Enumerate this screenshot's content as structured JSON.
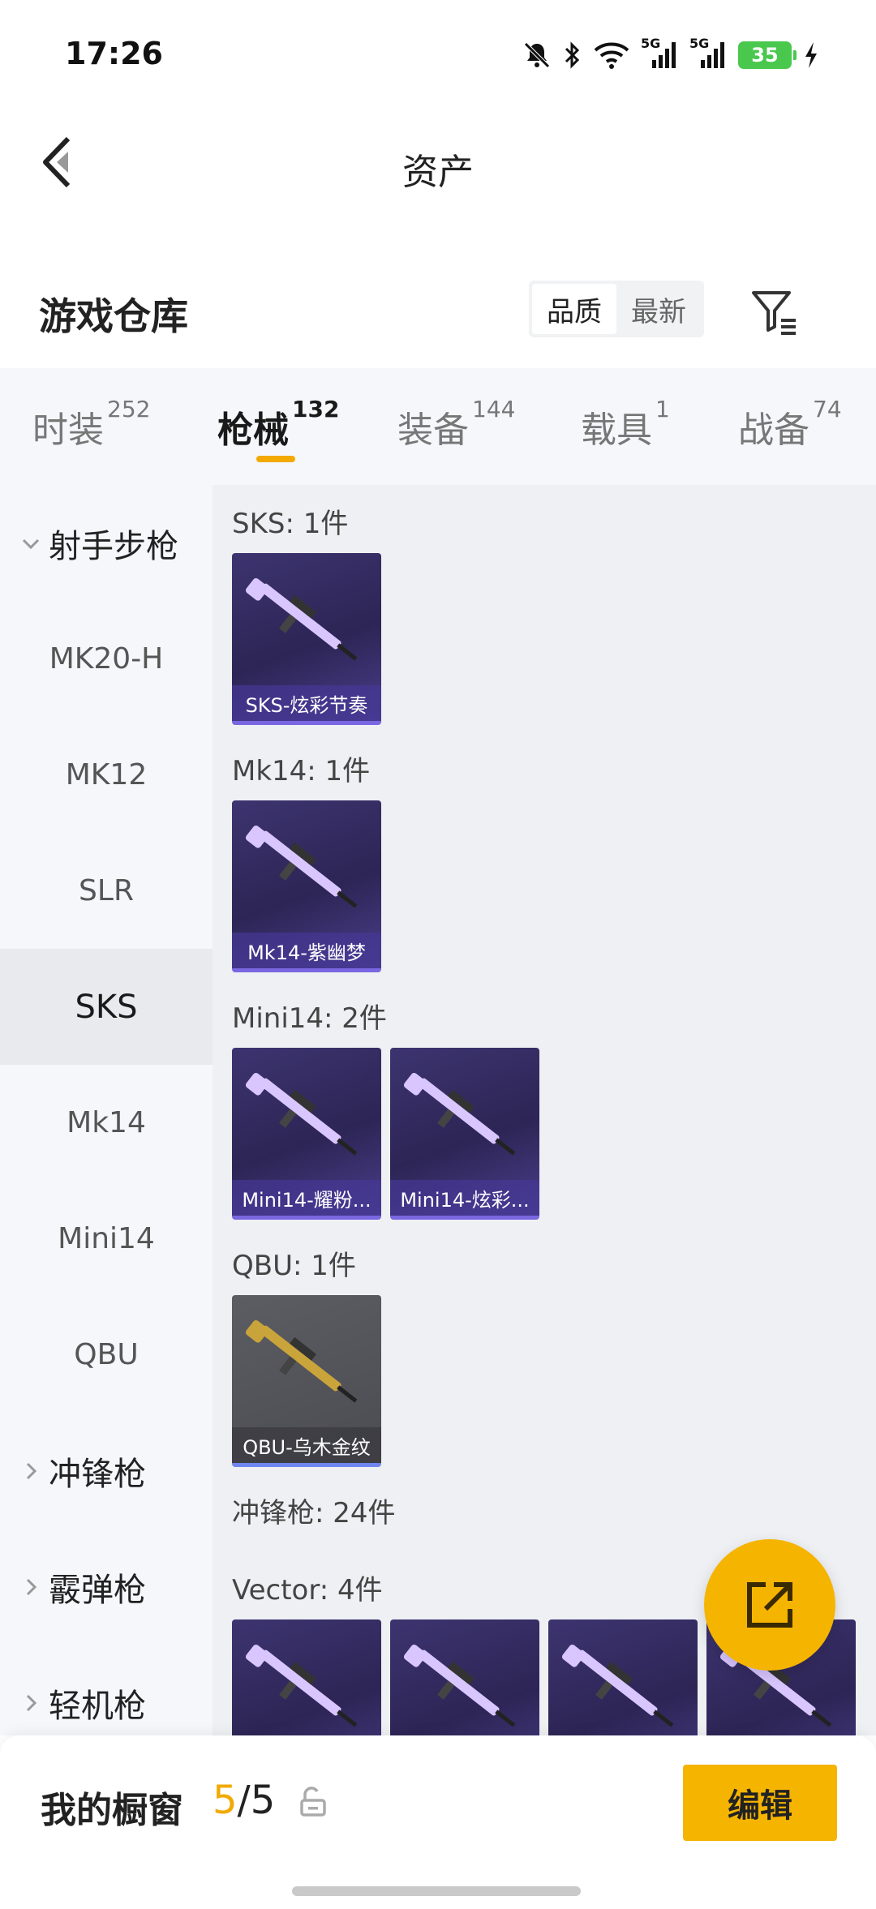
{
  "status_bar": {
    "time": "17:26",
    "network_a": "5G",
    "network_b": "5G",
    "battery": "35"
  },
  "header": {
    "title": "资产"
  },
  "warehouse": {
    "title": "游戏仓库",
    "sort_options": [
      "品质",
      "最新"
    ]
  },
  "tabs": [
    {
      "label": "时装",
      "count": "252"
    },
    {
      "label": "枪械",
      "count": "132"
    },
    {
      "label": "装备",
      "count": "144"
    },
    {
      "label": "载具",
      "count": "1"
    },
    {
      "label": "战备",
      "count": "74"
    }
  ],
  "sidebar": [
    {
      "label": "射手步枪",
      "type": "group",
      "expanded": true
    },
    {
      "label": "MK20-H",
      "type": "item"
    },
    {
      "label": "MK12",
      "type": "item"
    },
    {
      "label": "SLR",
      "type": "item"
    },
    {
      "label": "SKS",
      "type": "item",
      "selected": true
    },
    {
      "label": "Mk14",
      "type": "item"
    },
    {
      "label": "Mini14",
      "type": "item"
    },
    {
      "label": "QBU",
      "type": "item"
    },
    {
      "label": "冲锋枪",
      "type": "group",
      "expanded": false
    },
    {
      "label": "霰弹枪",
      "type": "group",
      "expanded": false
    },
    {
      "label": "轻机枪",
      "type": "group",
      "expanded": false
    }
  ],
  "groups": [
    {
      "title": "SKS: 1件",
      "items": [
        {
          "name": "SKS-炫彩节奏",
          "bg": "purple"
        }
      ]
    },
    {
      "title": "Mk14: 1件",
      "items": [
        {
          "name": "Mk14-紫幽梦",
          "bg": "purple"
        }
      ]
    },
    {
      "title": "Mini14: 2件",
      "items": [
        {
          "name": "Mini14-耀粉...",
          "bg": "purple"
        },
        {
          "name": "Mini14-炫彩...",
          "bg": "purple"
        }
      ]
    },
    {
      "title": "QBU: 1件",
      "items": [
        {
          "name": "QBU-乌木金纹",
          "bg": "gray"
        }
      ]
    },
    {
      "title": "冲锋枪: 24件",
      "items": []
    },
    {
      "title": "Vector: 4件",
      "items": [
        {
          "name": "",
          "bg": "purple"
        },
        {
          "name": "",
          "bg": "purple"
        },
        {
          "name": "",
          "bg": "purple"
        },
        {
          "name": "",
          "bg": "purple"
        }
      ]
    }
  ],
  "showcase": {
    "label": "我的橱窗",
    "current": "5",
    "separator": "/",
    "total": "5",
    "edit_label": "编辑"
  },
  "colors": {
    "accent": "#f5b400",
    "card_purple": "#2d2555",
    "card_gray": "#4b4c52"
  }
}
